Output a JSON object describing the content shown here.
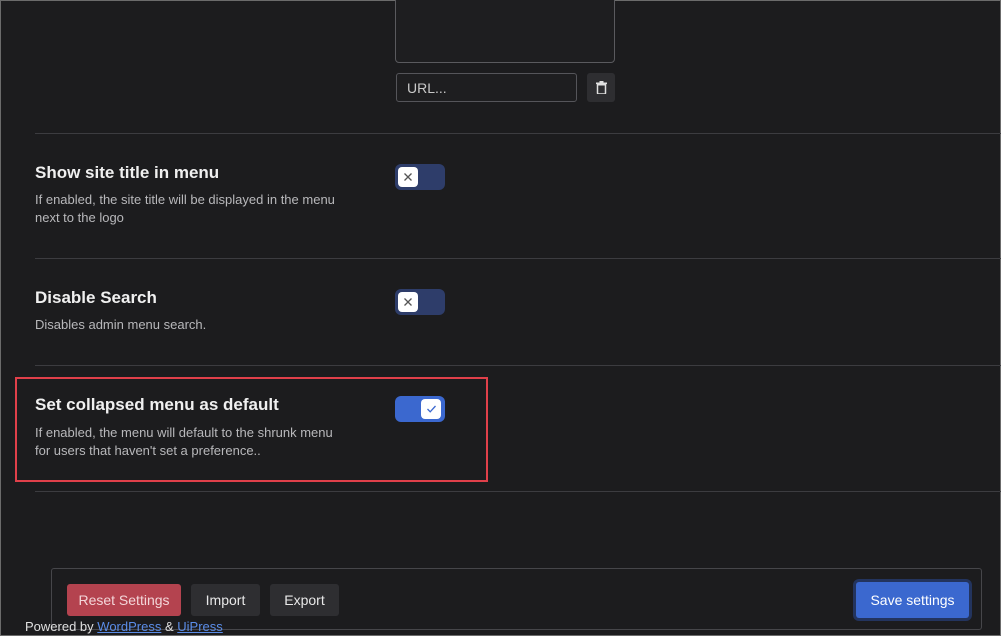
{
  "logo": {
    "url_placeholder": "URL..."
  },
  "settings": [
    {
      "title": "Show site title in menu",
      "description": "If enabled, the site title will be displayed in the menu next to the logo",
      "enabled": false
    },
    {
      "title": "Disable Search",
      "description": "Disables admin menu search.",
      "enabled": false
    },
    {
      "title": "Set collapsed menu as default",
      "description": "If enabled, the menu will default to the shrunk menu for users that haven't set a preference..",
      "enabled": true
    }
  ],
  "footer": {
    "reset_label": "Reset Settings",
    "import_label": "Import",
    "export_label": "Export",
    "save_label": "Save settings"
  },
  "credits": {
    "prefix": "Powered by",
    "wordpress": "WordPress",
    "amp": "&",
    "uipress": "UiPress"
  },
  "icons": {
    "trash": "trash-icon",
    "toggle_off": "x-icon",
    "toggle_on": "check-icon"
  },
  "colors": {
    "accent": "#3b68cf",
    "danger": "#b4434f",
    "highlight": "#e0404a",
    "background": "#1c1c1e"
  }
}
